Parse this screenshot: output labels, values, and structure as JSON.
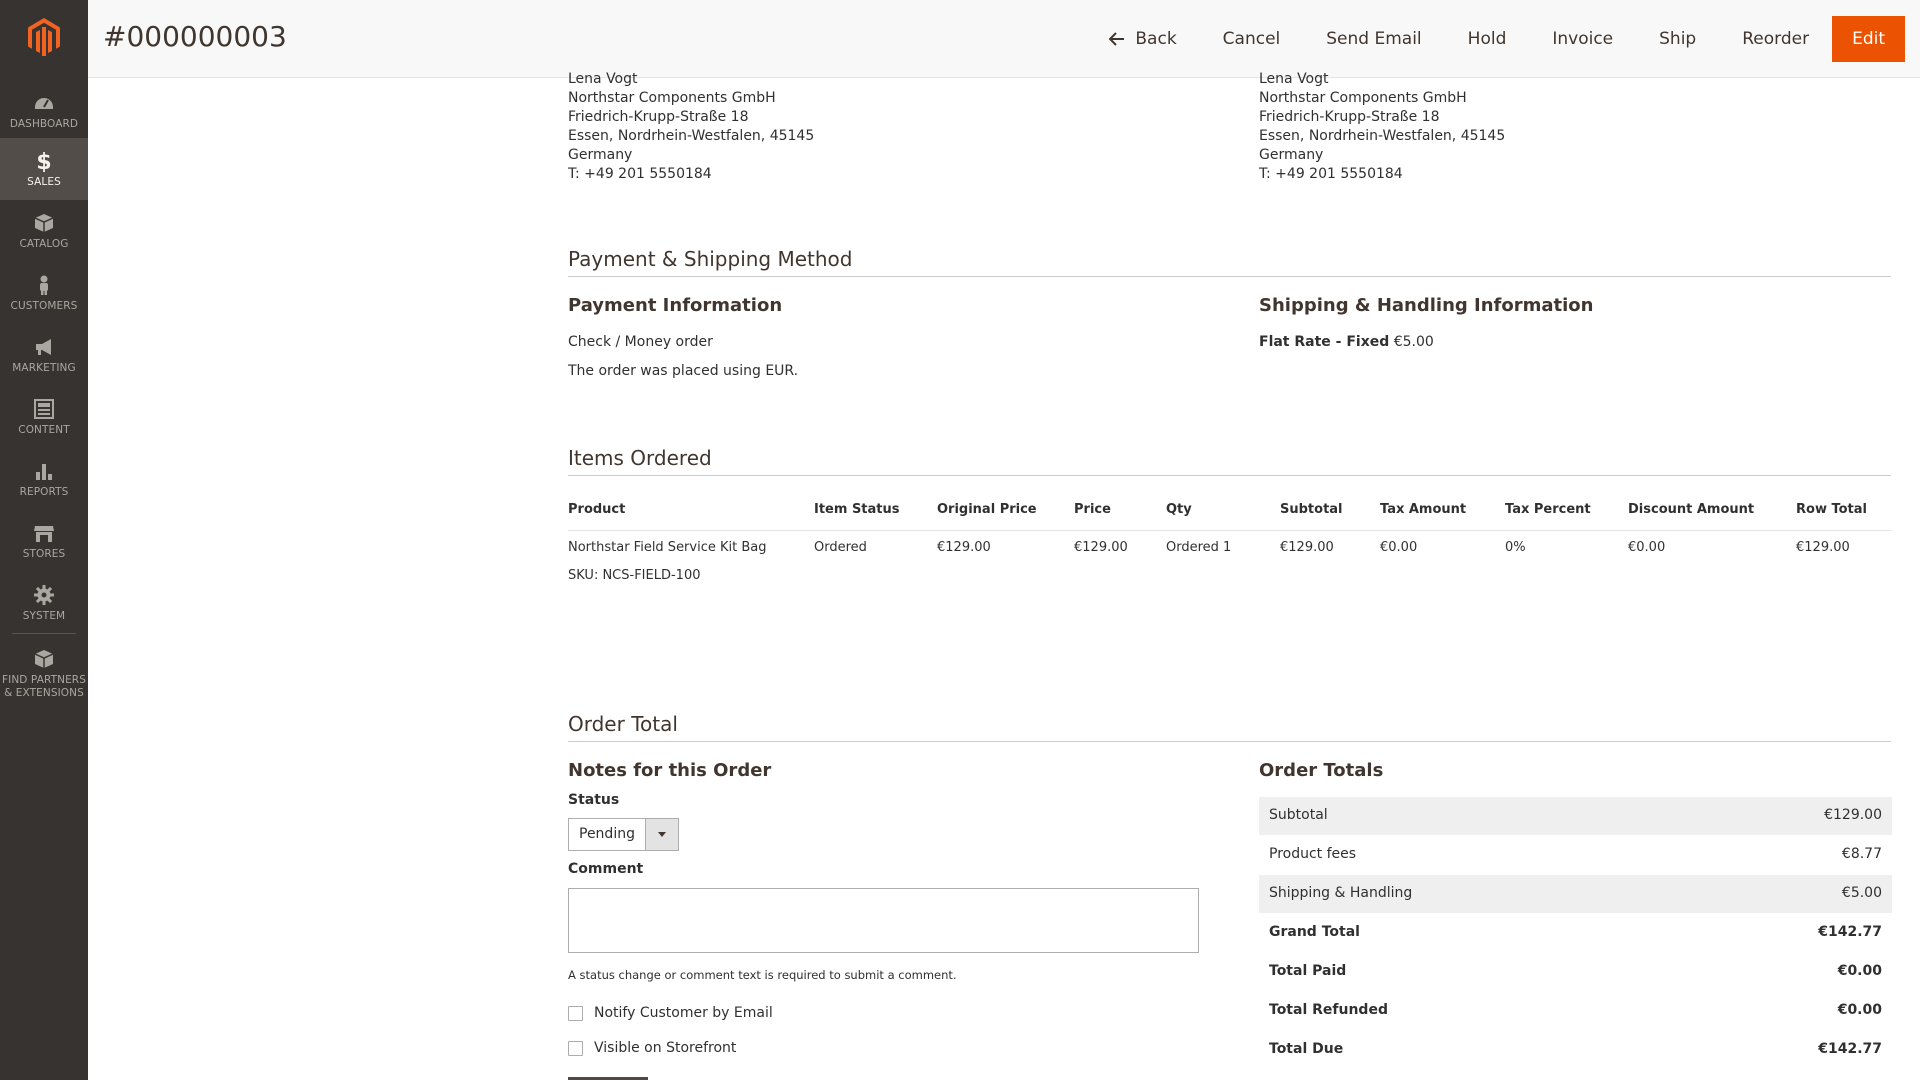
{
  "app": {
    "brand_color": "#eb5202",
    "sidebar_bg": "#373330"
  },
  "sidebar": {
    "items": [
      {
        "label": "DASHBOARD",
        "icon": "dashboard-icon"
      },
      {
        "label": "SALES",
        "icon": "dollar-icon",
        "active": true
      },
      {
        "label": "CATALOG",
        "icon": "box-icon"
      },
      {
        "label": "CUSTOMERS",
        "icon": "person-icon"
      },
      {
        "label": "MARKETING",
        "icon": "megaphone-icon"
      },
      {
        "label": "CONTENT",
        "icon": "layout-icon"
      },
      {
        "label": "REPORTS",
        "icon": "bar-chart-icon"
      },
      {
        "label": "STORES",
        "icon": "store-icon"
      },
      {
        "label": "SYSTEM",
        "icon": "gear-icon"
      }
    ],
    "partners_label_1": "FIND PARTNERS",
    "partners_label_2": "& EXTENSIONS"
  },
  "header": {
    "title": "#000000003",
    "actions": {
      "back": "Back",
      "cancel": "Cancel",
      "send_email": "Send Email",
      "hold": "Hold",
      "invoice": "Invoice",
      "ship": "Ship",
      "reorder": "Reorder",
      "edit": "Edit"
    }
  },
  "billing_address": {
    "name": "Lena Vogt",
    "company": "Northstar Components GmbH",
    "street": "Friedrich-Krupp-Straße 18",
    "city": "Essen, Nordrhein-Westfalen, 45145",
    "country": "Germany",
    "phone": "T: +49 201 5550184"
  },
  "shipping_address": {
    "name": "Lena Vogt",
    "company": "Northstar Components GmbH",
    "street": "Friedrich-Krupp-Straße 18",
    "city": "Essen, Nordrhein-Westfalen, 45145",
    "country": "Germany",
    "phone": "T: +49 201 5550184"
  },
  "payment_shipping": {
    "section_title": "Payment & Shipping Method",
    "payment_title": "Payment Information",
    "payment_method": "Check / Money order",
    "currency_note": "The order was placed using EUR.",
    "shipping_title": "Shipping & Handling Information",
    "shipping_method": "Flat Rate - Fixed",
    "shipping_price": "€5.00"
  },
  "items_ordered": {
    "section_title": "Items Ordered",
    "columns": [
      "Product",
      "Item Status",
      "Original Price",
      "Price",
      "Qty",
      "Subtotal",
      "Tax Amount",
      "Tax Percent",
      "Discount Amount",
      "Row Total"
    ],
    "rows": [
      {
        "product": "Northstar Field Service Kit Bag",
        "sku": "SKU: NCS-FIELD-100",
        "item_status": "Ordered",
        "original_price": "€129.00",
        "price": "€129.00",
        "qty": "Ordered 1",
        "subtotal": "€129.00",
        "tax_amount": "€0.00",
        "tax_percent": "0%",
        "discount_amount": "€0.00",
        "row_total": "€129.00"
      }
    ]
  },
  "order_total": {
    "section_title": "Order Total",
    "notes_title": "Notes for this Order",
    "status_label": "Status",
    "status_value": "Pending",
    "comment_label": "Comment",
    "comment_value": "",
    "comment_hint": "A status change or comment text is required to submit a comment.",
    "notify_label": "Notify Customer by Email",
    "visible_label": "Visible on Storefront",
    "totals_title": "Order Totals",
    "totals": [
      {
        "label": "Subtotal",
        "value": "€129.00"
      },
      {
        "label": "Product fees",
        "value": "€8.77"
      },
      {
        "label": "Shipping & Handling",
        "value": "€5.00"
      },
      {
        "label": "Grand Total",
        "value": "€142.77"
      },
      {
        "label": "Total Paid",
        "value": "€0.00"
      },
      {
        "label": "Total Refunded",
        "value": "€0.00"
      },
      {
        "label": "Total Due",
        "value": "€142.77"
      }
    ]
  }
}
